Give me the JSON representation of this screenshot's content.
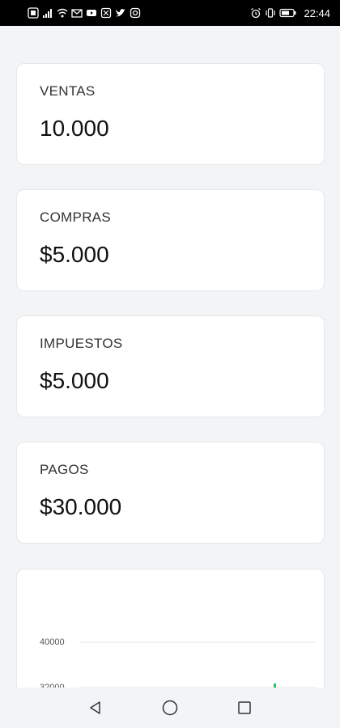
{
  "status_bar": {
    "time": "22:44",
    "left_icons": [
      "sim-icon",
      "signal-icon",
      "wifi-icon",
      "gmail-icon",
      "youtube-icon",
      "app-icon",
      "twitter-icon",
      "instagram-icon"
    ],
    "right_icons": [
      "alarm-icon",
      "vibrate-icon",
      "battery-icon"
    ]
  },
  "cards": [
    {
      "label": "VENTAS",
      "value": "10.000"
    },
    {
      "label": "COMPRAS",
      "value": "$5.000"
    },
    {
      "label": "IMPUESTOS",
      "value": "$5.000"
    },
    {
      "label": "PAGOS",
      "value": "$30.000"
    }
  ],
  "chart_data": {
    "type": "bar",
    "yticks": [
      "40000",
      "32000"
    ],
    "series_color": "#22c55e"
  },
  "nav_bar": {
    "buttons": [
      "back-icon",
      "home-icon",
      "recents-icon"
    ]
  }
}
